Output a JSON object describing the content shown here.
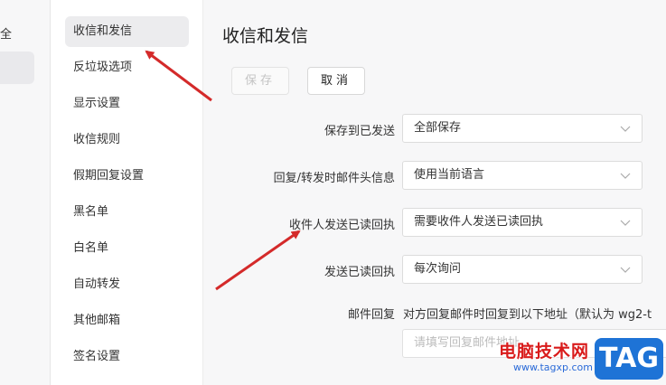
{
  "left_strip": {
    "fragment_text": "全"
  },
  "settings_nav": {
    "items": [
      {
        "label": "收信和发信",
        "active": true
      },
      {
        "label": "反垃圾选项"
      },
      {
        "label": "显示设置"
      },
      {
        "label": "收信规则"
      },
      {
        "label": "假期回复设置"
      },
      {
        "label": "黑名单"
      },
      {
        "label": "白名单"
      },
      {
        "label": "自动转发"
      },
      {
        "label": "其他邮箱"
      },
      {
        "label": "签名设置"
      }
    ]
  },
  "main": {
    "title": "收信和发信",
    "save_label": "保存",
    "cancel_label": "取消",
    "fields": [
      {
        "label": "保存到已发送",
        "value": "全部保存"
      },
      {
        "label": "回复/转发时邮件头信息",
        "value": "使用当前语言"
      },
      {
        "label": "收件人发送已读回执",
        "value": "需要收件人发送已读回执"
      },
      {
        "label": "发送已读回执",
        "value": "每次询问"
      }
    ],
    "reply": {
      "label": "邮件回复",
      "description": "对方回复邮件时回复到以下地址（默认为 wg2-t",
      "placeholder": "请填写回复邮件地址"
    }
  },
  "watermark": {
    "text": "电脑技术网",
    "url": "www.tagxp.com",
    "tag": "TAG"
  },
  "colors": {
    "arrow": "#d42a2a",
    "active_nav_bg": "#ececee",
    "main_bg": "#f7f7f8",
    "watermark_red": "#d91b1b",
    "watermark_blue": "#1e73d6"
  }
}
